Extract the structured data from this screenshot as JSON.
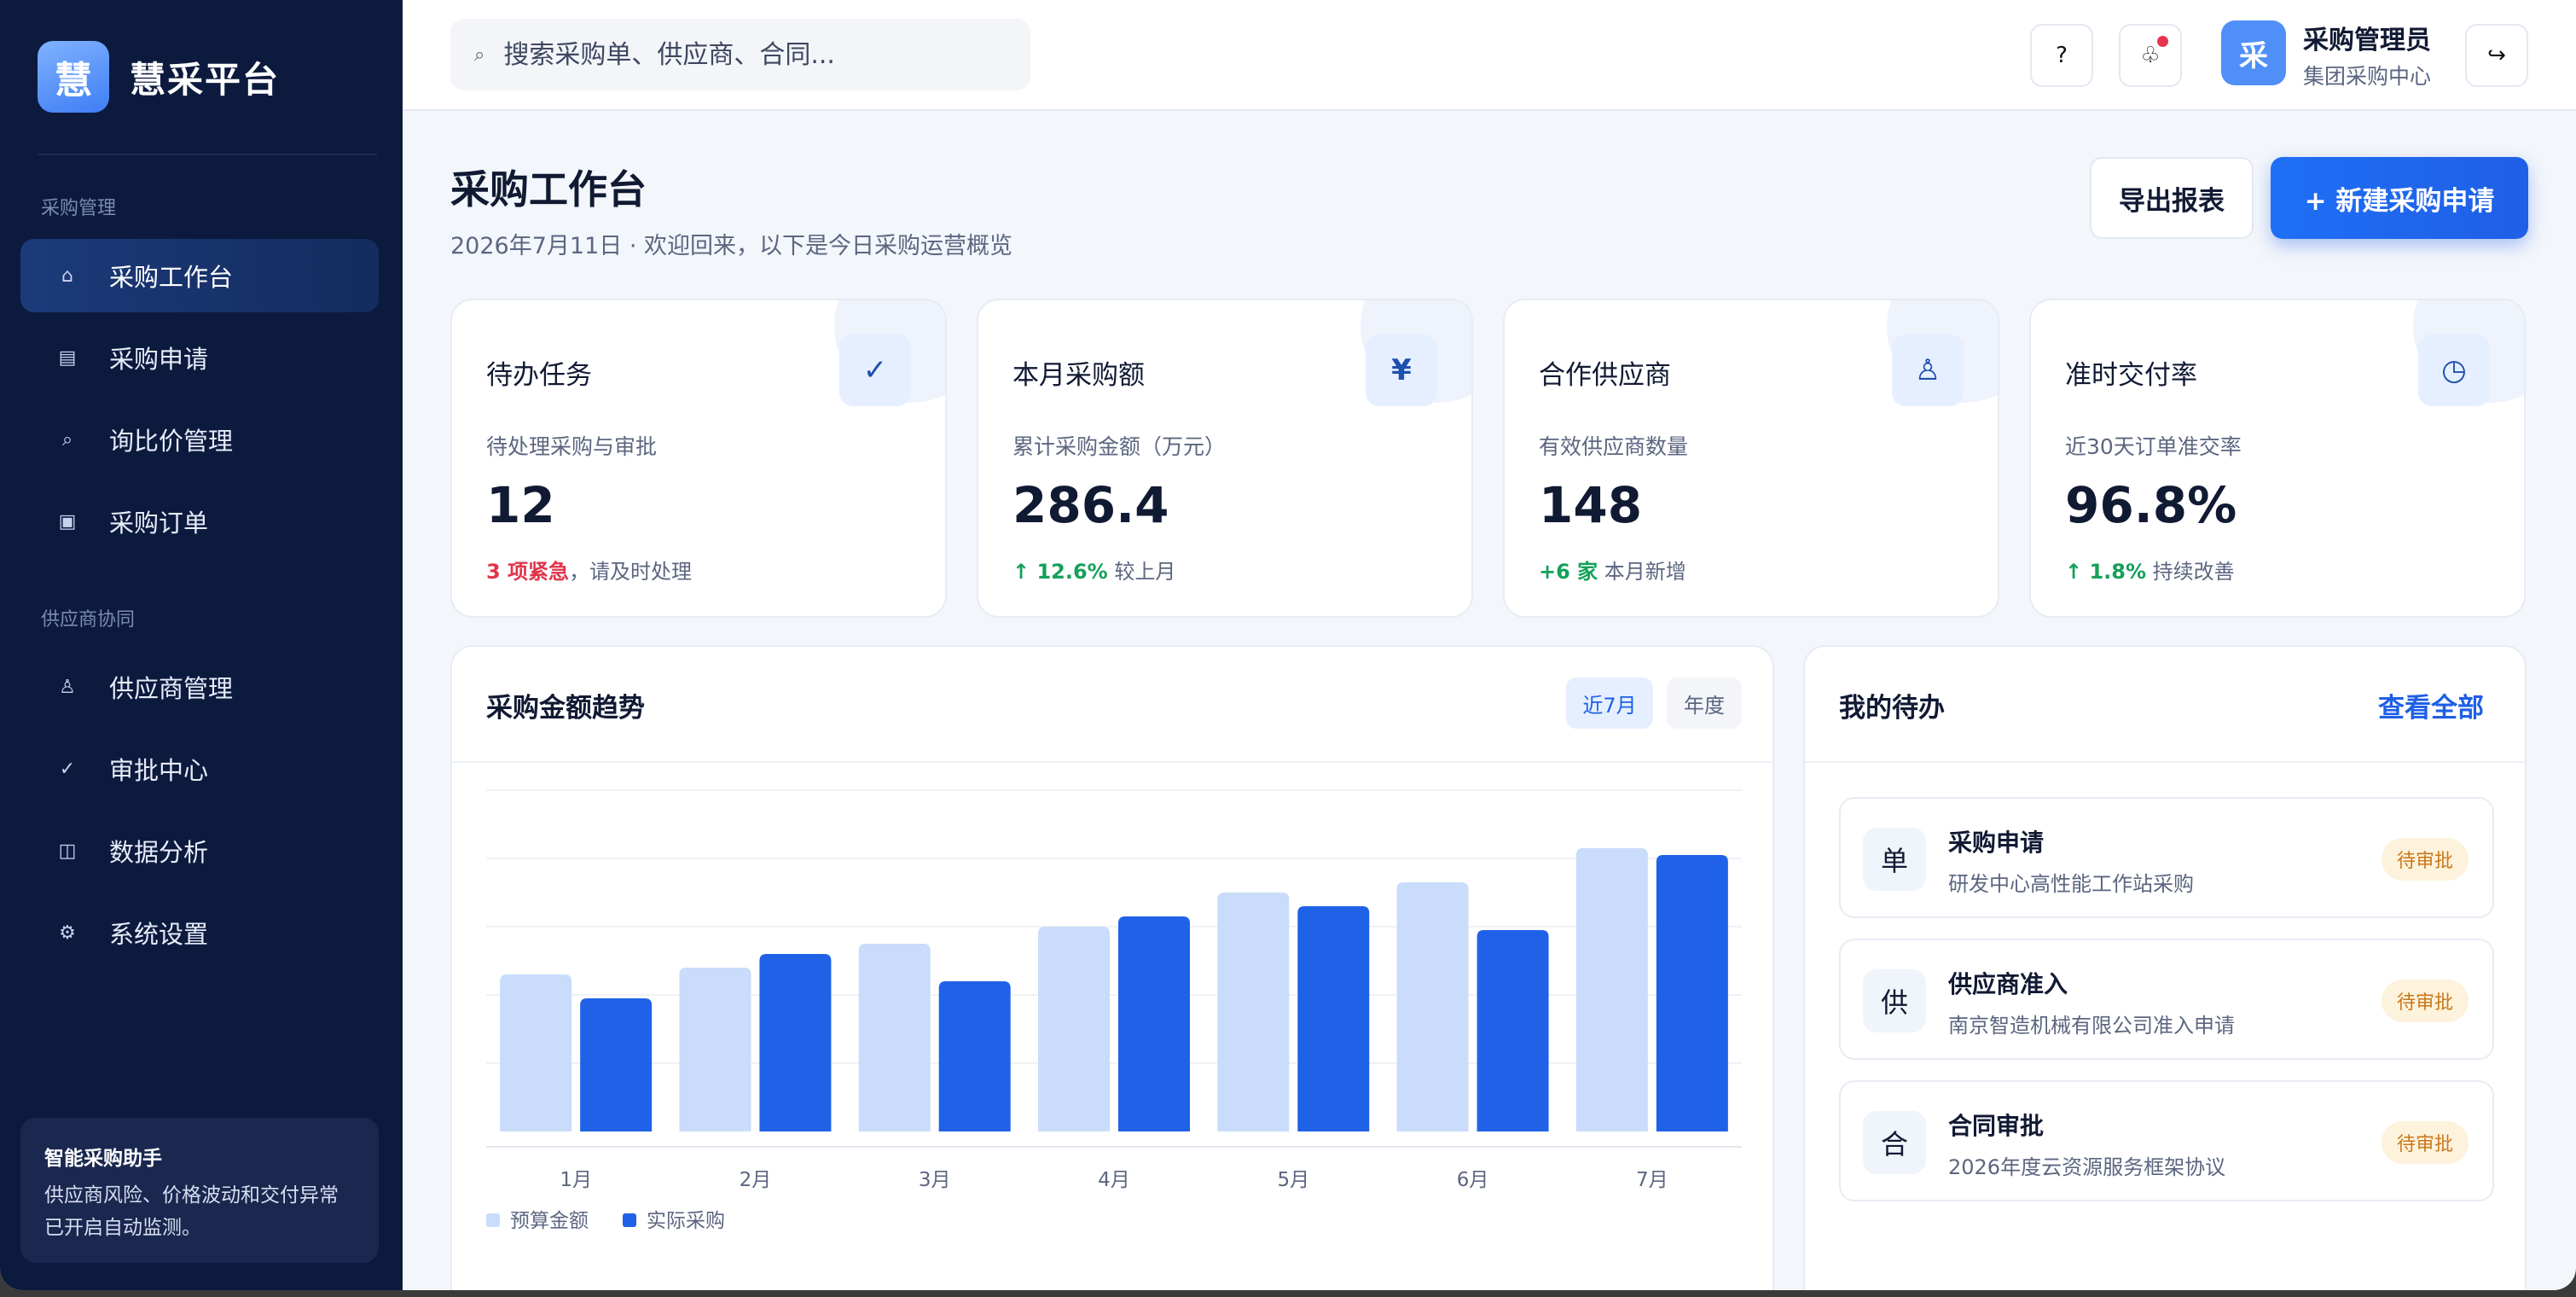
{
  "brand": {
    "logo_char": "慧",
    "name": "慧采平台"
  },
  "sidebar": {
    "sections": [
      {
        "title": "采购管理",
        "items": [
          {
            "label": "采购工作台",
            "icon": "⌂",
            "icon_name": "home-icon",
            "active": true
          },
          {
            "label": "采购申请",
            "icon": "▤",
            "icon_name": "document-icon",
            "active": false
          },
          {
            "label": "询比价管理",
            "icon": "⌕",
            "icon_name": "search-icon",
            "active": false
          },
          {
            "label": "采购订单",
            "icon": "▣",
            "icon_name": "order-icon",
            "active": false
          }
        ]
      },
      {
        "title": "供应商协同",
        "items": [
          {
            "label": "供应商管理",
            "icon": "♙",
            "icon_name": "supplier-icon",
            "active": false
          },
          {
            "label": "审批中心",
            "icon": "✓",
            "icon_name": "check-icon",
            "active": false
          },
          {
            "label": "数据分析",
            "icon": "◫",
            "icon_name": "analytics-icon",
            "active": false
          },
          {
            "label": "系统设置",
            "icon": "⚙",
            "icon_name": "gear-icon",
            "active": false
          }
        ]
      }
    ],
    "assistant": {
      "title": "智能采购助手",
      "text": "供应商风险、价格波动和交付异常已开启自动监测。"
    }
  },
  "topbar": {
    "search_placeholder": "搜索采购单、供应商、合同...",
    "help_icon": "?",
    "notify_icon": "♧",
    "logout_icon": "↪",
    "user": {
      "avatar_char": "采",
      "name": "采购管理员",
      "org": "集团采购中心"
    }
  },
  "header": {
    "title": "采购工作台",
    "subtitle": "2026年7月11日 · 欢迎回来，以下是今日采购运营概览",
    "export_label": "导出报表",
    "new_label": "+ 新建采购申请"
  },
  "stats": [
    {
      "title": "待办任务",
      "icon": "✓",
      "icon_name": "check-icon",
      "desc": "待处理采购与审批",
      "value": "12",
      "foot_hl": "3 项紧急",
      "foot_hl_color": "#e1344a",
      "foot_text": "，请及时处理"
    },
    {
      "title": "本月采购额",
      "icon": "¥",
      "icon_name": "yuan-icon",
      "desc": "累计采购金额（万元）",
      "value": "286.4",
      "foot_hl": "↑ 12.6%",
      "foot_hl_color": "#15a05a",
      "foot_text": " 较上月"
    },
    {
      "title": "合作供应商",
      "icon": "♙",
      "icon_name": "supplier-icon",
      "desc": "有效供应商数量",
      "value": "148",
      "foot_hl": "+6 家",
      "foot_hl_color": "#15a05a",
      "foot_text": " 本月新增"
    },
    {
      "title": "准时交付率",
      "icon": "◷",
      "icon_name": "clock-icon",
      "desc": "近30天订单准交率",
      "value": "96.8%",
      "foot_hl": "↑ 1.8%",
      "foot_hl_color": "#15a05a",
      "foot_text": " 持续改善"
    }
  ],
  "chart_card": {
    "title": "采购金额趋势",
    "range_active": "近7月",
    "range_other": "年度"
  },
  "chart_data": {
    "type": "bar",
    "categories": [
      "1月",
      "2月",
      "3月",
      "4月",
      "5月",
      "6月",
      "7月"
    ],
    "series": [
      {
        "name": "预算金额",
        "color": "#c9dcfb",
        "values": [
          46,
          48,
          55,
          60,
          70,
          73,
          83
        ]
      },
      {
        "name": "实际采购",
        "color": "#1f62e8",
        "values": [
          39,
          52,
          44,
          63,
          66,
          59,
          81
        ]
      }
    ],
    "ylim": [
      0,
      100
    ],
    "grid": true,
    "legend": "bottom-left"
  },
  "todo": {
    "title": "我的待办",
    "view_all": "查看全部",
    "items": [
      {
        "icon": "单",
        "title": "采购申请",
        "sub": "研发中心高性能工作站采购",
        "badge": "待审批"
      },
      {
        "icon": "供",
        "title": "供应商准入",
        "sub": "南京智造机械有限公司准入申请",
        "badge": "待审批"
      },
      {
        "icon": "合",
        "title": "合同审批",
        "sub": "2026年度云资源服务框架协议",
        "badge": "待审批"
      }
    ]
  }
}
